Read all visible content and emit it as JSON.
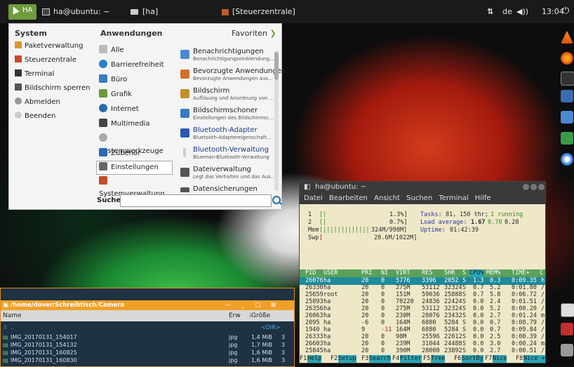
{
  "top_panel": {
    "menu_button_label": "HA",
    "tasks": [
      {
        "label": "ha@ubuntu: ~"
      },
      {
        "label": "[ha]"
      },
      {
        "label": "[Steuerzentrale]"
      }
    ],
    "keyboard_layout": "de",
    "time": "13:04"
  },
  "menu": {
    "system_header": "System",
    "apps_header": "Anwendungen",
    "favorites_label": "Favoriten",
    "system_items": [
      {
        "label": "Paketverwaltung"
      },
      {
        "label": "Steuerzentrale"
      },
      {
        "label": "Terminal"
      },
      {
        "label": "Bildschirm sperren"
      },
      {
        "label": "Abmelden"
      },
      {
        "label": "Beenden"
      }
    ],
    "app_categories": [
      {
        "label": "Alle"
      },
      {
        "label": "Barrierefreiheit"
      },
      {
        "label": "Büro"
      },
      {
        "label": "Grafik"
      },
      {
        "label": "Internet"
      },
      {
        "label": "Multimedia"
      },
      {
        "label": "Systemwerkzeuge"
      },
      {
        "label": "Zubehör"
      },
      {
        "label": "Einstellungen"
      },
      {
        "label": "Systemverwaltung"
      }
    ],
    "selected_category": "Einstellungen",
    "settings_items": [
      {
        "title": "Benachrichtigungen",
        "subtitle": "Benachrichtigungseinblendung..."
      },
      {
        "title": "Bevorzugte Anwendungen",
        "subtitle": "Bevorzugte Anwendungen aus..."
      },
      {
        "title": "Bildschirm",
        "subtitle": "Auflösung und Anordnung von ..."
      },
      {
        "title": "Bildschirmschoner",
        "subtitle": "Einstellungen des Bildschirmsc..."
      },
      {
        "title": "Bluetooth-Adapter",
        "subtitle": "Bluetooth-Adaptereigenschaft..."
      },
      {
        "title": "Bluetooth-Verwaltung",
        "subtitle": "Blueman-Bluetooth-Verwaltung"
      },
      {
        "title": "Dateiverwaltung",
        "subtitle": "Legt das Verhalten und das Aus..."
      },
      {
        "title": "Datensicherungen",
        "subtitle": ""
      }
    ],
    "search_label": "Suche:",
    "search_value": ""
  },
  "terminal": {
    "title": "ha@ubuntu: ~",
    "menu": [
      "Datei",
      "Bearbeiten",
      "Ansicht",
      "Suchen",
      "Terminal",
      "Hilfe"
    ],
    "cpu1": {
      "label": "1",
      "bar": "[|",
      "value": "1.3%]"
    },
    "cpu2": {
      "label": "2",
      "bar": "[|",
      "value": "0.7%]"
    },
    "mem": {
      "label": "Mem",
      "bar": "[|||||||||||||",
      "value": "324M/998M]"
    },
    "swp": {
      "label": "Swp",
      "bar": "[",
      "value": "20.6M/1022M]"
    },
    "tasks_line": {
      "prefix": "Tasks:",
      "tasks": "81,",
      "thr": "150 thr;",
      "running": "1 running"
    },
    "load_line": {
      "prefix": "Load average:",
      "v1": "1.67",
      "v2": "0.70",
      "v3": "0.28"
    },
    "uptime_line": {
      "prefix": "Uptime:",
      "value": "01:42:39"
    },
    "columns": [
      "PID",
      "USER",
      "PRI",
      "NI",
      "VIRT",
      "RES",
      "SHR",
      "S",
      "CPU%",
      "MEM%",
      "TIME+",
      "C"
    ],
    "processes": [
      {
        "pid": "26076",
        "user": "ha",
        "pri": "20",
        "ni": "0",
        "virt": "5776",
        "res": "3396",
        "shr": "2052",
        "s": "S",
        "cpu": "1.3",
        "mem": "0.3",
        "time": "0:09.35",
        "c": "h"
      },
      {
        "pid": "26330",
        "user": "ha",
        "pri": "20",
        "ni": "0",
        "virt": "275M",
        "res": "53112",
        "shr": "32324",
        "s": "S",
        "cpu": "0.7",
        "mem": "5.2",
        "time": "0:01.80",
        "c": "/"
      },
      {
        "pid": "25659",
        "user": "root",
        "pri": "20",
        "ni": "0",
        "virt": "151M",
        "res": "59036",
        "shr": "25888",
        "s": "S",
        "cpu": "0.7",
        "mem": "5.8",
        "time": "0:06.72",
        "c": "/"
      },
      {
        "pid": "25893",
        "user": "ha",
        "pri": "20",
        "ni": "0",
        "virt": "70220",
        "res": "24836",
        "shr": "22424",
        "s": "S",
        "cpu": "0.0",
        "mem": "2.4",
        "time": "0:01.51",
        "c": "/"
      },
      {
        "pid": "26356",
        "user": "ha",
        "pri": "20",
        "ni": "0",
        "virt": "275M",
        "res": "53112",
        "shr": "32324",
        "s": "S",
        "cpu": "0.0",
        "mem": "5.2",
        "time": "0:00.20",
        "c": "/"
      },
      {
        "pid": "26063",
        "user": "ha",
        "pri": "20",
        "ni": "0",
        "virt": "230M",
        "res": "28076",
        "shr": "23432",
        "s": "S",
        "cpu": "0.0",
        "mem": "2.7",
        "time": "0:01.24",
        "c": "m"
      },
      {
        "pid": "2095",
        "user": "ha",
        "pri": "-6",
        "ni": "0",
        "virt": "164M",
        "res": "6880",
        "shr": "5284",
        "s": "S",
        "cpu": "0.0",
        "mem": "0.7",
        "time": "0:08.79",
        "c": "/"
      },
      {
        "pid": "1940",
        "user": "ha",
        "pri": "9",
        "ni": "-11",
        "virt": "164M",
        "res": "6880",
        "shr": "5284",
        "s": "S",
        "cpu": "0.0",
        "mem": "0.7",
        "time": "0:09.84",
        "c": "/"
      },
      {
        "pid": "26333",
        "user": "ha",
        "pri": "20",
        "ni": "0",
        "virt": "98M",
        "res": "25596",
        "shr": "22012",
        "s": "S",
        "cpu": "0.0",
        "mem": "2.5",
        "time": "0:00.39",
        "c": "/"
      },
      {
        "pid": "26603",
        "user": "ha",
        "pri": "20",
        "ni": "0",
        "virt": "239M",
        "res": "31044",
        "shr": "24488",
        "s": "S",
        "cpu": "0.0",
        "mem": "3.0",
        "time": "0:00.24",
        "c": "m"
      },
      {
        "pid": "25845",
        "user": "ha",
        "pri": "20",
        "ni": "0",
        "virt": "390M",
        "res": "28008",
        "shr": "23892",
        "s": "S",
        "cpu": "0.0",
        "mem": "2.7",
        "time": "0:00.51",
        "c": "/"
      }
    ],
    "fkeys": [
      {
        "key": "F1",
        "label": "Help"
      },
      {
        "key": "F2",
        "label": "Setup"
      },
      {
        "key": "F3",
        "label": "Search"
      },
      {
        "key": "F4",
        "label": "Filter"
      },
      {
        "key": "F5",
        "label": "Tree"
      },
      {
        "key": "F6",
        "label": "SortBy"
      },
      {
        "key": "F7",
        "label": "Nice"
      },
      {
        "key": "F8",
        "label": "Nice +"
      }
    ]
  },
  "file_manager": {
    "path": "/home/dover/Schreibtisch/Camera",
    "title_buttons": "— _ □ ⊠",
    "columns": {
      "name": "Name",
      "ext": "Erw",
      "size": "Größe"
    },
    "up_label": "..",
    "up_size": "<DIR>",
    "files": [
      {
        "name": "IMG_20170131_154017",
        "ext": "jpg",
        "size": "1,4 MiB",
        "extra": "3"
      },
      {
        "name": "IMG_20170131_154132",
        "ext": "jpg",
        "size": "1,7 MiB",
        "extra": "3"
      },
      {
        "name": "IMG_20170131_160825",
        "ext": "jpg",
        "size": "1,6 MiB",
        "extra": "3"
      },
      {
        "name": "IMG_20170131_160830",
        "ext": "jpg",
        "size": "1,6 MiB",
        "extra": "3"
      }
    ]
  },
  "colors": {
    "panel_bg": "#1a1a1a",
    "menu_bg": "#f4f4f4",
    "accent_green": "#6f9c3d",
    "terminal_bg": "#efe8c8",
    "htop_header": "#5aa15a",
    "htop_selected": "#1f8a9a",
    "fm_title": "#f0a028",
    "fm_bg": "#1e3242"
  }
}
